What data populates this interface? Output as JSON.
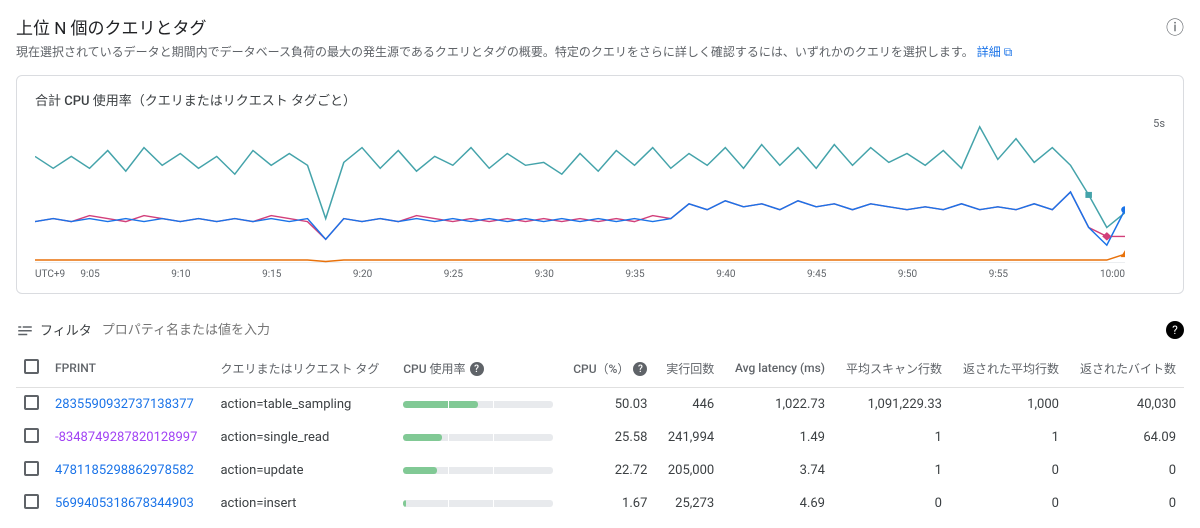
{
  "header": {
    "title": "上位 N 個のクエリとタグ",
    "subtitle": "現在選択されているデータと期間内でデータベース負荷の最大の発生源であるクエリとタグの概要。特定のクエリをさらに詳しく確認するには、いずれかのクエリを選択します。",
    "details_link": "詳細"
  },
  "chart": {
    "title": "合計 CPU 使用率（クエリまたはリクエスト タグごと）",
    "y_mark": "5s",
    "x_ticks": [
      "UTC+9",
      "9:05",
      "9:10",
      "9:15",
      "9:20",
      "9:25",
      "9:30",
      "9:35",
      "9:40",
      "9:45",
      "9:50",
      "9:55",
      "10:00"
    ]
  },
  "chart_data": {
    "type": "line",
    "ylim": [
      0,
      5
    ],
    "ylabel": "seconds",
    "xlabel": "time (UTC+9)",
    "title": "合計 CPU 使用率（クエリまたはリクエスト タグごと）",
    "x": [
      0,
      1,
      2,
      3,
      4,
      5,
      6,
      7,
      8,
      9,
      10,
      11,
      12,
      13,
      14,
      15,
      16,
      17,
      18,
      19,
      20,
      21,
      22,
      23,
      24,
      25,
      26,
      27,
      28,
      29,
      30,
      31,
      32,
      33,
      34,
      35,
      36,
      37,
      38,
      39,
      40,
      41,
      42,
      43,
      44,
      45,
      46,
      47,
      48,
      49,
      50,
      51,
      52,
      53,
      54,
      55,
      56,
      57,
      58,
      59,
      60
    ],
    "series": [
      {
        "name": "action=table_sampling",
        "color": "#44a3aa",
        "values": [
          3.6,
          3.2,
          3.6,
          3.2,
          3.8,
          3.1,
          3.9,
          3.3,
          3.7,
          3.2,
          3.6,
          3.0,
          3.8,
          3.3,
          3.7,
          3.3,
          1.5,
          3.4,
          3.9,
          3.2,
          3.8,
          3.1,
          3.6,
          3.3,
          3.9,
          3.2,
          3.7,
          3.3,
          3.4,
          3.0,
          3.7,
          3.1,
          3.8,
          3.3,
          3.9,
          3.2,
          3.7,
          3.3,
          3.9,
          3.2,
          4.0,
          3.3,
          3.9,
          3.2,
          4.0,
          3.3,
          3.9,
          3.4,
          3.7,
          3.3,
          3.8,
          3.2,
          4.6,
          3.5,
          4.2,
          3.4,
          3.9,
          3.3,
          2.3,
          1.2,
          1.7
        ]
      },
      {
        "name": "action=single_read",
        "color": "#d23f7a",
        "values": [
          1.4,
          1.5,
          1.4,
          1.6,
          1.5,
          1.4,
          1.6,
          1.5,
          1.4,
          1.5,
          1.4,
          1.5,
          1.4,
          1.6,
          1.5,
          1.4,
          0.8,
          1.5,
          1.4,
          1.5,
          1.4,
          1.6,
          1.5,
          1.4,
          1.5,
          1.4,
          1.5,
          1.4,
          1.5,
          1.4,
          1.5,
          1.4,
          1.5,
          1.4,
          1.6,
          1.5,
          2.0,
          1.8,
          2.1,
          1.9,
          2.0,
          1.8,
          2.1,
          1.9,
          2.0,
          1.8,
          2.0,
          1.9,
          1.8,
          1.9,
          1.8,
          2.0,
          1.8,
          1.9,
          1.8,
          2.0,
          1.8,
          2.4,
          1.2,
          0.9,
          0.9
        ]
      },
      {
        "name": "action=update",
        "color": "#1a73e8",
        "values": [
          1.4,
          1.5,
          1.4,
          1.5,
          1.4,
          1.5,
          1.4,
          1.5,
          1.4,
          1.5,
          1.4,
          1.5,
          1.4,
          1.5,
          1.4,
          1.5,
          0.8,
          1.5,
          1.4,
          1.5,
          1.4,
          1.5,
          1.4,
          1.5,
          1.4,
          1.5,
          1.4,
          1.5,
          1.4,
          1.5,
          1.4,
          1.5,
          1.4,
          1.5,
          1.4,
          1.5,
          2.0,
          1.8,
          2.1,
          1.9,
          2.0,
          1.8,
          2.1,
          1.9,
          2.0,
          1.8,
          2.0,
          1.9,
          1.8,
          1.9,
          1.8,
          2.0,
          1.8,
          1.9,
          1.8,
          2.0,
          1.8,
          2.4,
          1.2,
          0.6,
          1.8
        ]
      },
      {
        "name": "action=insert",
        "color": "#e8710a",
        "values": [
          0.1,
          0.1,
          0.1,
          0.1,
          0.1,
          0.1,
          0.1,
          0.1,
          0.1,
          0.1,
          0.1,
          0.1,
          0.1,
          0.1,
          0.1,
          0.1,
          0.05,
          0.1,
          0.1,
          0.1,
          0.1,
          0.1,
          0.1,
          0.1,
          0.1,
          0.1,
          0.1,
          0.1,
          0.1,
          0.1,
          0.1,
          0.1,
          0.1,
          0.1,
          0.1,
          0.1,
          0.1,
          0.1,
          0.1,
          0.1,
          0.1,
          0.1,
          0.1,
          0.1,
          0.1,
          0.1,
          0.1,
          0.1,
          0.1,
          0.1,
          0.1,
          0.1,
          0.1,
          0.1,
          0.1,
          0.1,
          0.1,
          0.1,
          0.1,
          0.1,
          0.3
        ]
      }
    ]
  },
  "filter": {
    "label": "フィルタ",
    "placeholder": "プロパティ名または値を入力"
  },
  "table": {
    "headers": {
      "fprint": "FPRINT",
      "query_tag": "クエリまたはリクエスト タグ",
      "cpu_usage": "CPU 使用率",
      "cpu_pct": "CPU（%）",
      "exec_count": "実行回数",
      "avg_latency": "Avg latency (ms)",
      "avg_scan": "平均スキャン行数",
      "avg_returned": "返された平均行数",
      "bytes_returned": "返されたバイト数"
    },
    "rows": [
      {
        "fprint": "2835590932737138377",
        "selected": false,
        "tag": "action=table_sampling",
        "bar": 50.03,
        "cpu_pct": "50.03",
        "exec": "446",
        "latency": "1,022.73",
        "scan": "1,091,229.33",
        "returned": "1,000",
        "bytes": "40,030"
      },
      {
        "fprint": "-8348749287820128997",
        "selected": true,
        "tag": "action=single_read",
        "bar": 25.58,
        "cpu_pct": "25.58",
        "exec": "241,994",
        "latency": "1.49",
        "scan": "1",
        "returned": "1",
        "bytes": "64.09"
      },
      {
        "fprint": "4781185298862978582",
        "selected": false,
        "tag": "action=update",
        "bar": 22.72,
        "cpu_pct": "22.72",
        "exec": "205,000",
        "latency": "3.74",
        "scan": "1",
        "returned": "0",
        "bytes": "0"
      },
      {
        "fprint": "5699405318678344903",
        "selected": false,
        "tag": "action=insert",
        "bar": 1.67,
        "cpu_pct": "1.67",
        "exec": "25,273",
        "latency": "4.69",
        "scan": "0",
        "returned": "0",
        "bytes": "0"
      }
    ]
  }
}
